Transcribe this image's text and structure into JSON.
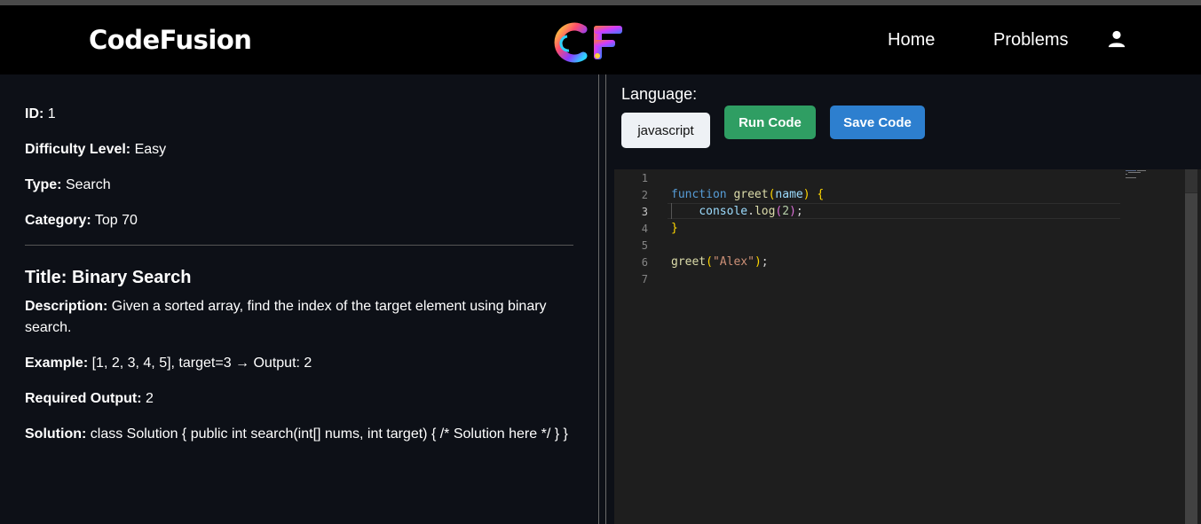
{
  "navbar": {
    "brand": "CodeFusion",
    "logo_text": "CF",
    "links": [
      "Home",
      "Problems"
    ],
    "user_icon": "user-icon"
  },
  "problem": {
    "id_label": "ID:",
    "id": "1",
    "difficulty_label": "Difficulty Level:",
    "difficulty": "Easy",
    "type_label": "Type:",
    "type": "Search",
    "category_label": "Category:",
    "category": "Top 70",
    "title": "Title: Binary Search",
    "description_label": "Description:",
    "description": "Given a sorted array, find the index of the target element using binary search.",
    "example_label": "Example:",
    "example": "[1, 2, 3, 4, 5], target=3 → Output: 2",
    "required_output_label": "Required Output:",
    "required_output": "2",
    "solution_label": "Solution:",
    "solution": "class Solution { public int search(int[] nums, int target) { /* Solution here */ } }"
  },
  "editor_panel": {
    "language_label": "Language:",
    "language": "javascript",
    "run_label": "Run Code",
    "save_label": "Save Code",
    "colors": {
      "run": "#2f9e63",
      "save": "#2d7fcf"
    }
  },
  "code": {
    "line_numbers": [
      "1",
      "2",
      "3",
      "4",
      "5",
      "6",
      "7"
    ],
    "active_line": 3,
    "lines": [
      "",
      "function greet(name) {",
      "    console.log(2);",
      "}",
      "",
      "greet(\"Alex\");",
      ""
    ]
  }
}
